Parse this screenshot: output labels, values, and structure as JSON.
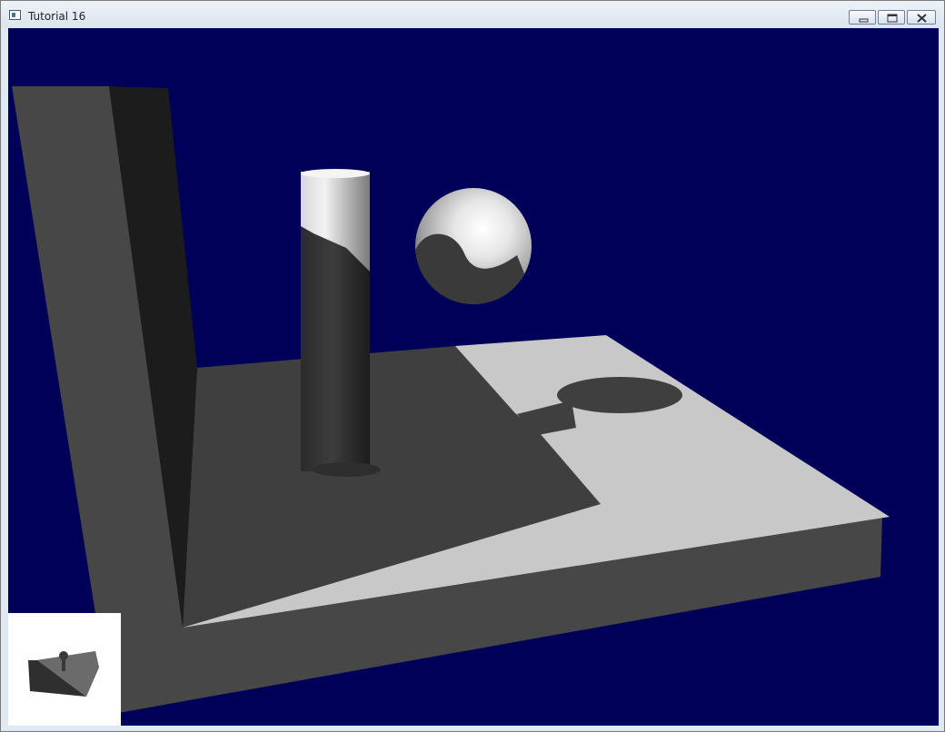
{
  "window": {
    "title": "Tutorial 16",
    "icons": {
      "app": "app-window-icon",
      "minimize": "minimize-icon",
      "maximize": "maximize-icon",
      "close": "close-icon"
    }
  },
  "viewport": {
    "background_color": "#000058",
    "shadow_map_preview_color": "#ffffff"
  }
}
